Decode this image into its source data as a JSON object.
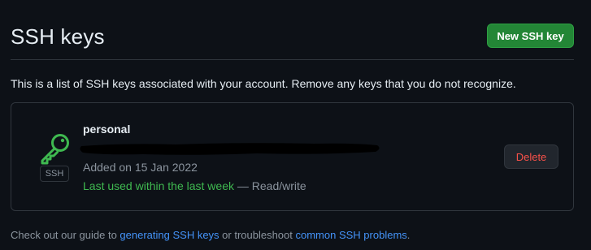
{
  "header": {
    "title": "SSH keys",
    "new_key_label": "New SSH key"
  },
  "intro": "This is a list of SSH keys associated with your account. Remove any keys that you do not recognize.",
  "keys": [
    {
      "name": "personal",
      "badge": "SSH",
      "added": "Added on 15 Jan 2022",
      "last_used": "Last used within the last week",
      "access_sep": " — ",
      "access": "Read/write",
      "delete_label": "Delete",
      "fingerprint_redacted": true,
      "icon": "key-icon"
    }
  ],
  "footer": {
    "prefix": "Check out our guide to ",
    "link1": "generating SSH keys",
    "middle": " or troubleshoot ",
    "link2": "common SSH problems",
    "suffix": "."
  },
  "colors": {
    "background": "#0d1117",
    "border": "#30363d",
    "accent_green": "#238636",
    "recent_green": "#3fb950",
    "danger": "#f85149",
    "link": "#4493f8"
  }
}
